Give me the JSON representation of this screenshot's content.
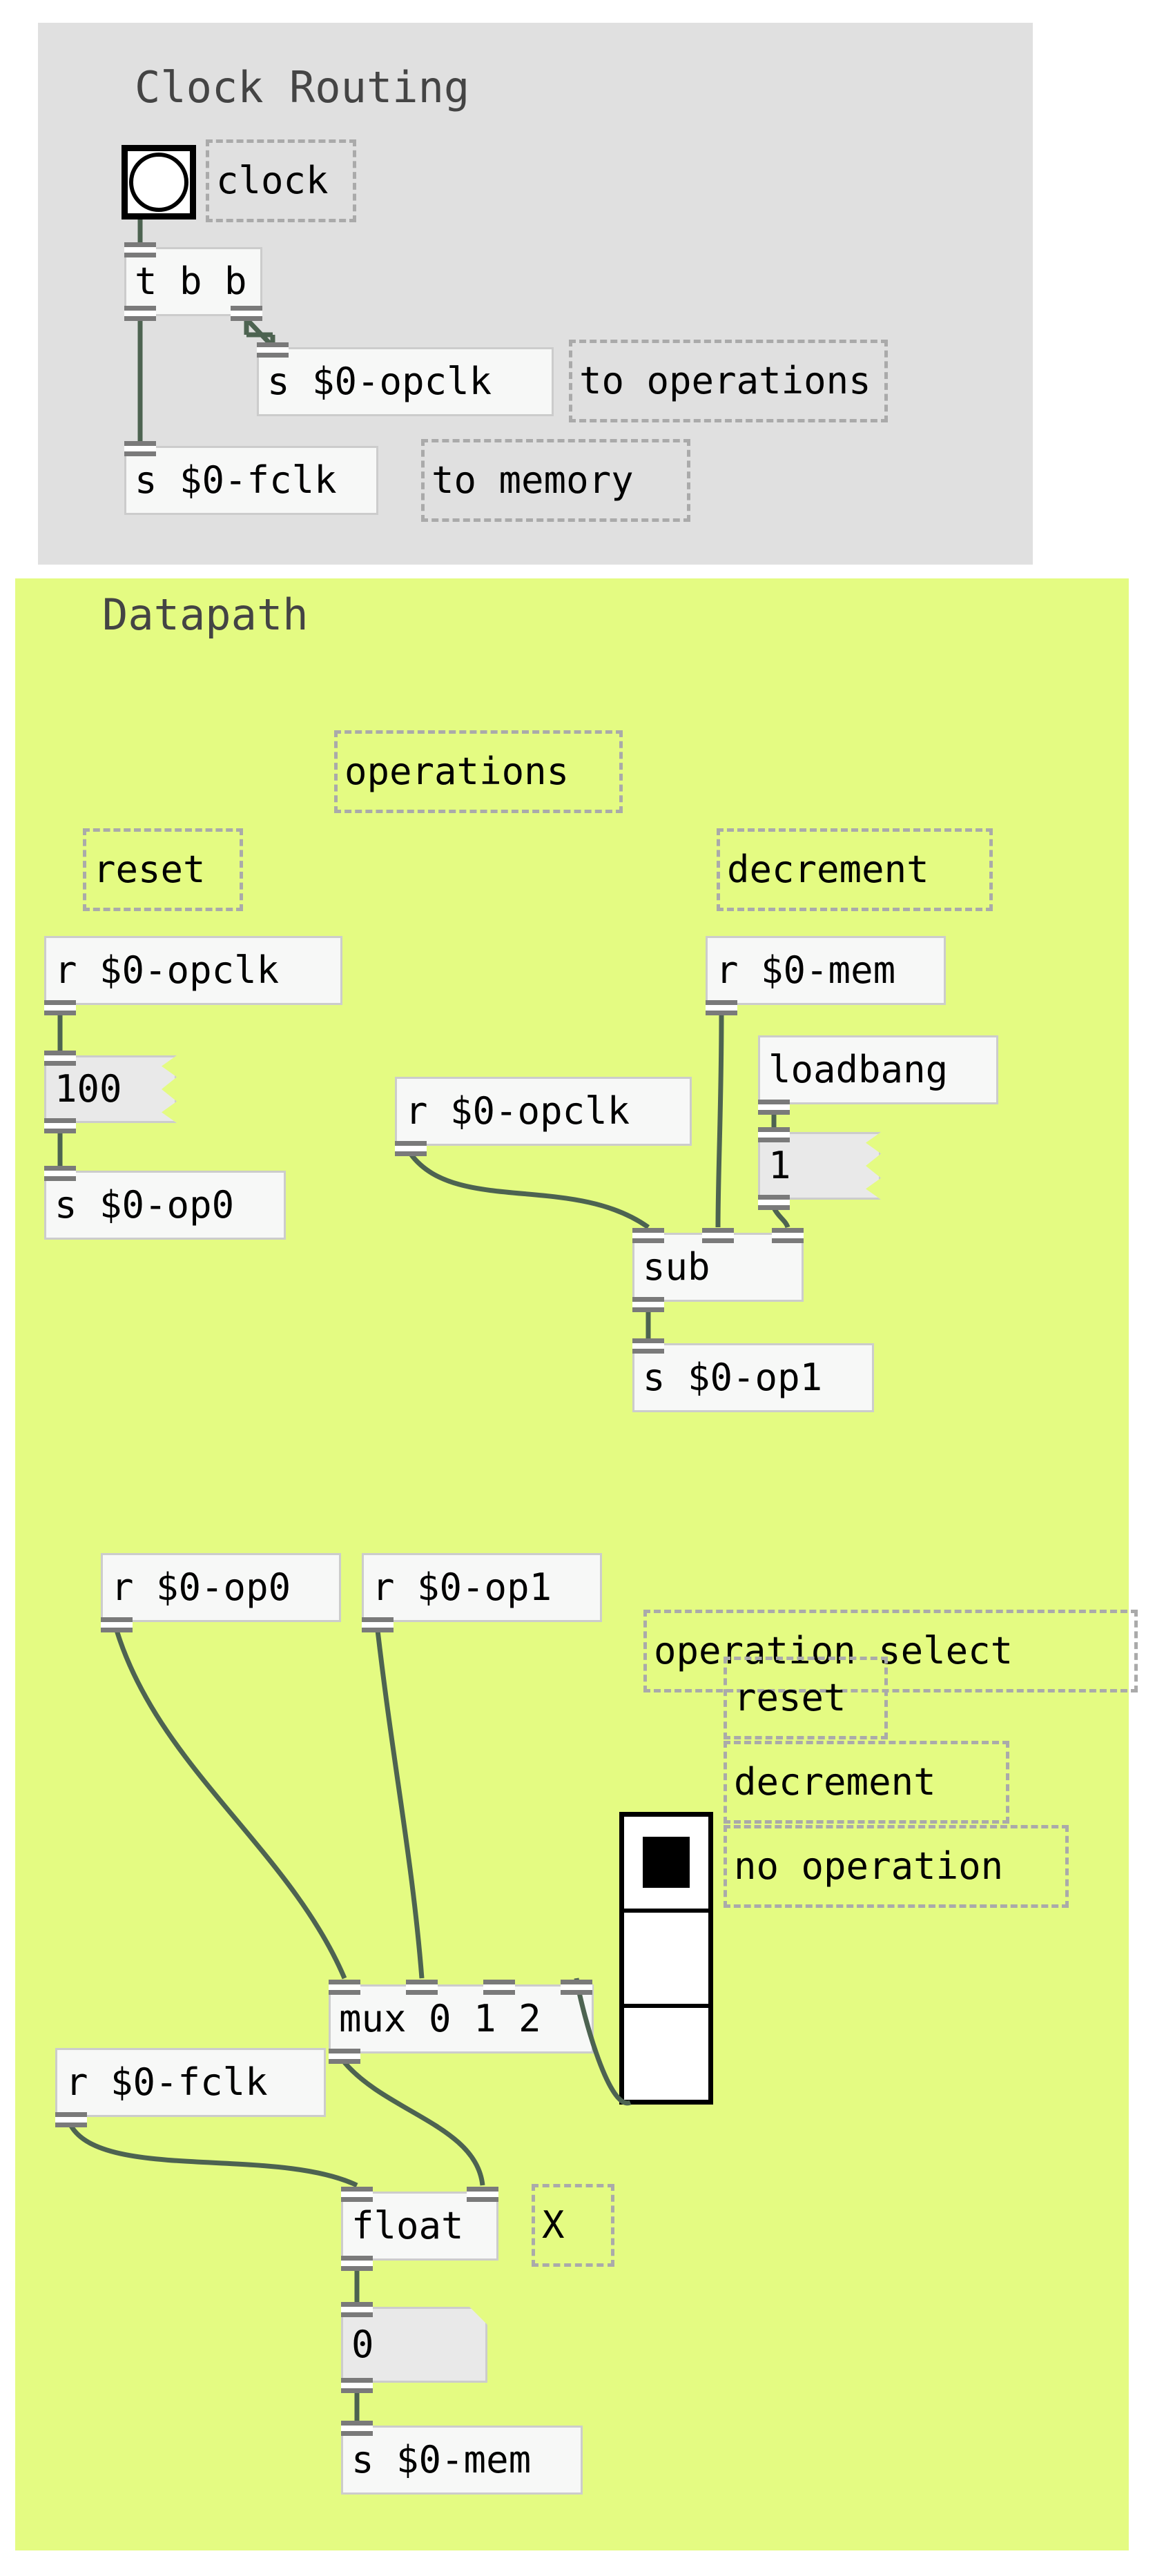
{
  "patch": {
    "title": "Pure Data counter patch",
    "background": "#ffffff"
  },
  "canvases": [
    {
      "id": "clock-routing",
      "label": "Clock Routing",
      "color": "#e0e0e0"
    },
    {
      "id": "datapath",
      "label": "Datapath",
      "color": "#e4fb82"
    }
  ],
  "clock_routing": {
    "title": "Clock Routing",
    "bang_comment": "clock",
    "trigger": "t b b",
    "send_opclk": "s $0-opclk",
    "comment_to_operations": "to operations",
    "send_fclk": "s $0-fclk",
    "comment_to_memory": "to memory"
  },
  "datapath": {
    "title": "Datapath",
    "comment_operations": "operations",
    "comment_reset": "reset",
    "comment_decrement": "decrement",
    "receive_opclk_reset": "r $0-opclk",
    "msg_100": "100",
    "send_op0": "s $0-op0",
    "receive_mem": "r $0-mem",
    "loadbang": "loadbang",
    "msg_1": "1",
    "receive_opclk_sub": "r $0-opclk",
    "sub": "sub",
    "send_op1": "s $0-op1",
    "receive_op0": "r $0-op0",
    "receive_op1": "r $0-op1",
    "comment_operation_select": "operation select",
    "radio_labels": [
      "reset",
      "decrement",
      "no operation"
    ],
    "radio_selected_index": 0,
    "mux": "mux 0 1 2",
    "receive_fclk": "r $0-fclk",
    "float": "float",
    "comment_x": "X",
    "numbox_value": "0",
    "send_mem": "s $0-mem"
  },
  "colors": {
    "clock_canvas": "#e0e0e0",
    "datapath_canvas": "#e4fb82",
    "object_fill": "#f7f8f7",
    "object_border": "#cccccc",
    "message_fill": "#e9e9e9",
    "comment_border": "#aaaaaa",
    "cord": "#4d6351",
    "nub": "#7a7a7a",
    "title_text": "#444444",
    "body_text": "#000000"
  }
}
